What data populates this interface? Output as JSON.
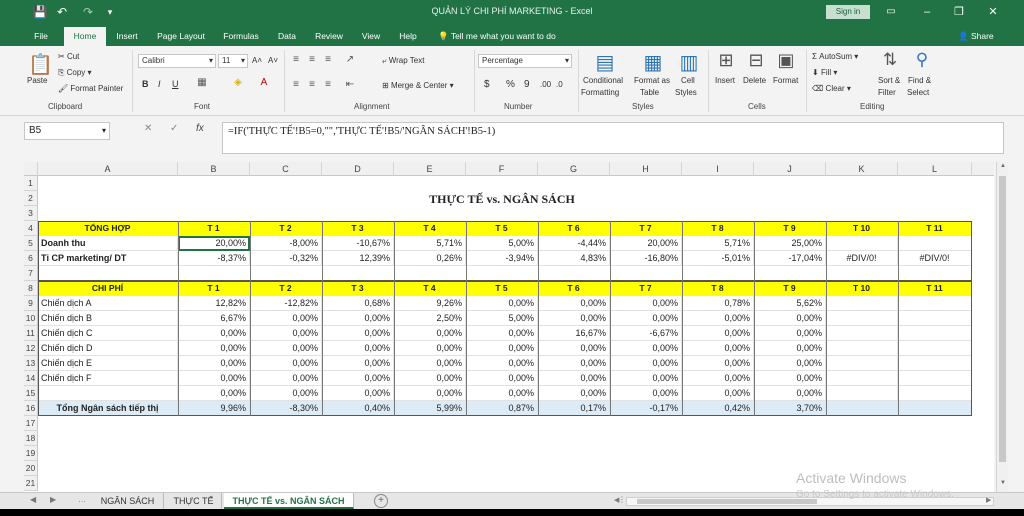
{
  "window": {
    "title": "QUẢN LÝ CHI PHÍ MARKETING  -  Excel",
    "signin": "Sign in",
    "minimize": "–",
    "restore": "❐",
    "close": "✕",
    "ribbon_display": "▭"
  },
  "quick_access": {
    "save": "💾",
    "undo": "↶",
    "redo": "↷",
    "customize": "▾"
  },
  "tabs": [
    "File",
    "Home",
    "Insert",
    "Page Layout",
    "Formulas",
    "Data",
    "Review",
    "View",
    "Help"
  ],
  "tell_me": "Tell me what you want to do",
  "share": "Share",
  "ribbon": {
    "clipboard": {
      "label": "Clipboard",
      "paste": "Paste",
      "cut": "Cut",
      "copy": "Copy",
      "format_painter": "Format Painter"
    },
    "font": {
      "label": "Font",
      "name": "Calibri",
      "size": "11",
      "bold": "B",
      "italic": "I",
      "underline": "U",
      "grow": "A˄",
      "shrink": "A˅"
    },
    "alignment": {
      "label": "Alignment",
      "wrap": "Wrap Text",
      "merge": "Merge & Center"
    },
    "number": {
      "label": "Number",
      "format": "Percentage",
      "currency": "$",
      "percent": "%",
      "comma": "9",
      "inc_dec": ".00",
      "dec_dec": ".0"
    },
    "styles": {
      "label": "Styles",
      "conditional": "Conditional",
      "conditional2": "Formatting",
      "format_table": "Format as",
      "format_table2": "Table",
      "cell_styles": "Cell",
      "cell_styles2": "Styles"
    },
    "cells": {
      "label": "Cells",
      "insert": "Insert",
      "delete": "Delete",
      "format": "Format"
    },
    "editing": {
      "label": "Editing",
      "autosum": "AutoSum",
      "fill": "Fill",
      "clear": "Clear",
      "sort": "Sort &",
      "sort2": "Filter",
      "find": "Find &",
      "find2": "Select"
    }
  },
  "formula_bar": {
    "name_box": "B5",
    "cancel": "✕",
    "enter": "✓",
    "fx": "fx",
    "formula": "=IF('THỰC TẾ'!B5=0,\"\",'THỰC TẾ'!B5/'NGÂN SÁCH'!B5-1)"
  },
  "columns": [
    "A",
    "B",
    "C",
    "D",
    "E",
    "F",
    "G",
    "H",
    "I",
    "J",
    "K",
    "L"
  ],
  "rows": [
    "1",
    "2",
    "3",
    "4",
    "5",
    "6",
    "7",
    "8",
    "9",
    "10",
    "11",
    "12",
    "13",
    "14",
    "15",
    "16",
    "17",
    "18",
    "19",
    "20",
    "21"
  ],
  "sheet": {
    "title": "THỰC TẾ vs. NGÂN SÁCH",
    "months": [
      "T 1",
      "T 2",
      "T 3",
      "T 4",
      "T 5",
      "T 6",
      "T 7",
      "T 8",
      "T 9",
      "T 10",
      "T 11"
    ],
    "summary_header": "TỔNG HỢP",
    "revenue_label": "Doanh thu",
    "revenue": [
      "20,00%",
      "-8,00%",
      "-10,67%",
      "5,71%",
      "5,00%",
      "-4,44%",
      "20,00%",
      "5,71%",
      "25,00%",
      "",
      ""
    ],
    "ratio_label": "Tỉ CP marketing/ DT",
    "ratio": [
      "-8,37%",
      "-0,32%",
      "12,39%",
      "0,26%",
      "-3,94%",
      "4,83%",
      "-16,80%",
      "-5,01%",
      "-17,04%",
      "#DIV/0!",
      "#DIV/0!"
    ],
    "cost_header": "CHI PHÍ",
    "campaigns": [
      {
        "name": "Chiến dịch A",
        "values": [
          "12,82%",
          "-12,82%",
          "0,68%",
          "9,26%",
          "0,00%",
          "0,00%",
          "0,00%",
          "0,78%",
          "5,62%"
        ]
      },
      {
        "name": "Chiến dịch B",
        "values": [
          "6,67%",
          "0,00%",
          "0,00%",
          "2,50%",
          "5,00%",
          "0,00%",
          "0,00%",
          "0,00%",
          "0,00%"
        ]
      },
      {
        "name": "Chiến dịch C",
        "values": [
          "0,00%",
          "0,00%",
          "0,00%",
          "0,00%",
          "0,00%",
          "16,67%",
          "-6,67%",
          "0,00%",
          "0,00%"
        ]
      },
      {
        "name": "Chiến dịch D",
        "values": [
          "0,00%",
          "0,00%",
          "0,00%",
          "0,00%",
          "0,00%",
          "0,00%",
          "0,00%",
          "0,00%",
          "0,00%"
        ]
      },
      {
        "name": "Chiến dịch E",
        "values": [
          "0,00%",
          "0,00%",
          "0,00%",
          "0,00%",
          "0,00%",
          "0,00%",
          "0,00%",
          "0,00%",
          "0,00%"
        ]
      },
      {
        "name": "Chiến dịch F",
        "values": [
          "0,00%",
          "0,00%",
          "0,00%",
          "0,00%",
          "0,00%",
          "0,00%",
          "0,00%",
          "0,00%",
          "0,00%"
        ]
      },
      {
        "name": "",
        "values": [
          "0,00%",
          "0,00%",
          "0,00%",
          "0,00%",
          "0,00%",
          "0,00%",
          "0,00%",
          "0,00%",
          "0,00%"
        ]
      }
    ],
    "total_label": "Tổng Ngân sách tiếp thị",
    "total": [
      "9,96%",
      "-8,30%",
      "0,40%",
      "5,99%",
      "0,87%",
      "0,17%",
      "-0,17%",
      "0,42%",
      "3,70%"
    ]
  },
  "sheet_tabs": [
    "NGÂN SÁCH",
    "THỰC TẾ",
    "THỰC TẾ vs. NGÂN SÁCH"
  ],
  "watermark": {
    "line1": "Activate Windows",
    "line2": "Go to Settings to activate Windows."
  },
  "colors": {
    "excel_green": "#217346",
    "header_yellow": "#ffff00",
    "total_blue": "#ddebf7"
  }
}
